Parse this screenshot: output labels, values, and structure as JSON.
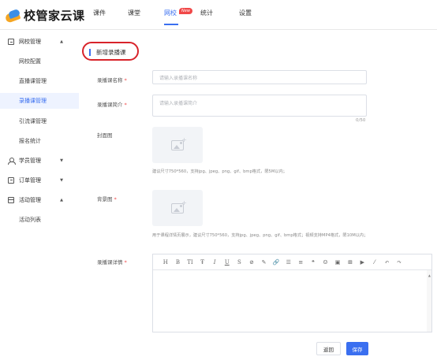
{
  "app": {
    "logo_text": "校管家云课"
  },
  "nav": {
    "items": [
      "课件",
      "课堂",
      "网校",
      "统计",
      "设置"
    ],
    "active": "网校",
    "badge": "New"
  },
  "sidebar": {
    "groups": [
      {
        "label": "网校管理",
        "icon": "square-icon",
        "expanded": true,
        "items": [
          "网校配置",
          "直播课管理",
          "录播课管理",
          "引流课管理",
          "报名统计"
        ]
      },
      {
        "label": "学员管理",
        "icon": "user-icon",
        "expanded": false,
        "items": []
      },
      {
        "label": "订单管理",
        "icon": "order-icon",
        "expanded": false,
        "items": []
      },
      {
        "label": "活动管理",
        "icon": "activity-icon",
        "expanded": true,
        "items": [
          "活动列表"
        ]
      }
    ],
    "active_item": "录播课管理"
  },
  "form": {
    "title": "新增录播课",
    "name_label": "录播课名称",
    "name_placeholder": "请输入录播课名称",
    "intro_label": "录播课简介",
    "intro_placeholder": "请输入录播课简介",
    "intro_counter": "0/50",
    "cover_label": "封面图",
    "cover_hint": "建议尺寸750*560，支持jpg、jpeg、png、gif、bmp格式，限5M以内；",
    "bg_label": "背景图",
    "bg_hint": "用于课程详情页展示，建议尺寸750*560，支持jpg、jpeg、png、gif、bmp格式；视频支持MP4格式，限10M以内；",
    "detail_label": "录播课详情",
    "required_mark": "*",
    "toolbar": [
      "H",
      "B",
      "TI",
      "Ŧ",
      "I",
      "U",
      "S",
      "⊘",
      "✎",
      "🔗",
      "☰",
      "≡",
      "❝",
      "☺",
      "▣",
      "⊞",
      "▶",
      "⁄",
      "↶",
      "↷"
    ],
    "back_label": "返回",
    "save_label": "保存"
  },
  "colors": {
    "accent": "#3a6ff0",
    "required": "#f04848",
    "highlight": "#d8232a"
  }
}
